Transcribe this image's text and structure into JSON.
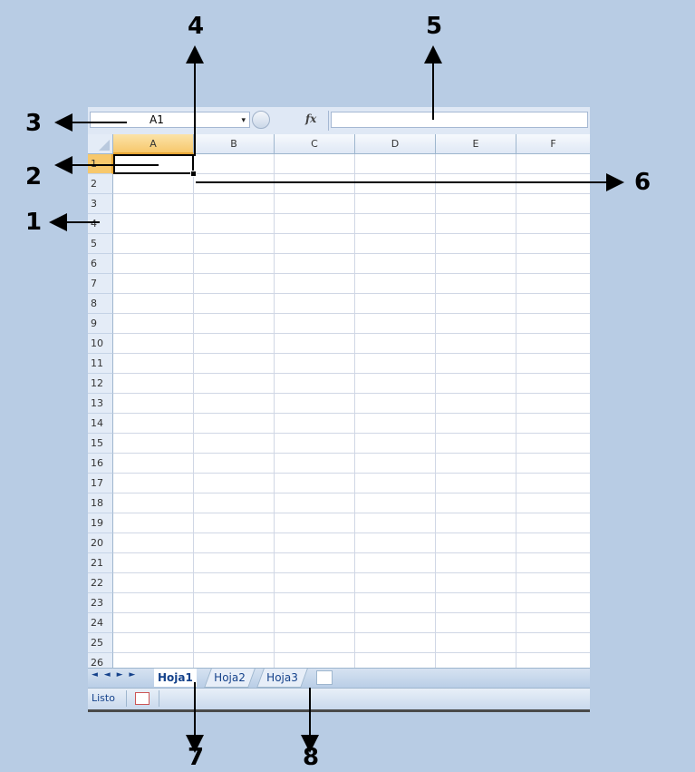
{
  "formula_bar": {
    "name_box": "A1",
    "name_box_dropdown": "▾",
    "fx_label": "fx",
    "formula_value": ""
  },
  "columns": [
    "A",
    "B",
    "C",
    "D",
    "E",
    "F"
  ],
  "rows": [
    "1",
    "2",
    "3",
    "4",
    "5",
    "6",
    "7",
    "8",
    "9",
    "10",
    "11",
    "12",
    "13",
    "14",
    "15",
    "16",
    "17",
    "18",
    "19",
    "20",
    "21",
    "22",
    "23",
    "24",
    "25",
    "26"
  ],
  "active_cell": {
    "column": "A",
    "row": "1"
  },
  "sheet_tabs": {
    "nav": "◄ ◄ ► ►",
    "tabs": [
      "Hoja1",
      "Hoja2",
      "Hoja3"
    ],
    "active": "Hoja1",
    "new_sheet_icon": "insert-sheet-icon"
  },
  "status_bar": {
    "status": "Listo",
    "macro_icon": "macro-record-icon"
  },
  "callouts": {
    "c1": "1",
    "c2": "2",
    "c3": "3",
    "c4": "4",
    "c5": "5",
    "c6": "6",
    "c7": "7",
    "c8": "8"
  },
  "colors": {
    "background": "#b8cce4",
    "selected_header": "#f7c86c",
    "tab_text": "#15428b"
  }
}
